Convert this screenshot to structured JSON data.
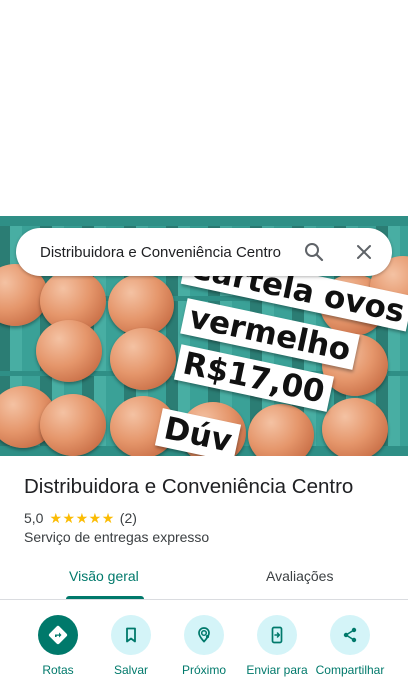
{
  "search": {
    "query": "Distribuidora e Conveniência Centro"
  },
  "hero_photo": {
    "sign_lines": [
      "Cartela ovos",
      "vermelho",
      "R$17,00",
      "Dúv"
    ]
  },
  "place": {
    "name": "Distribuidora e Conveniência Centro",
    "rating": "5,0",
    "stars": 5,
    "review_count": "(2)",
    "category": "Serviço de entregas expresso"
  },
  "tabs": [
    {
      "label": "Visão geral",
      "selected": true
    },
    {
      "label": "Avaliações",
      "selected": false
    }
  ],
  "actions": [
    {
      "label": "Rotas",
      "icon": "directions-icon"
    },
    {
      "label": "Salvar",
      "icon": "bookmark-icon"
    },
    {
      "label": "Próximo",
      "icon": "nearby-icon"
    },
    {
      "label": "Enviar para",
      "icon": "send-to-phone-icon"
    },
    {
      "label": "Compartilhar",
      "icon": "share-icon"
    }
  ],
  "colors": {
    "accent": "#00796b",
    "action_bg": "#d4f4f8",
    "star": "#fbbc04"
  }
}
